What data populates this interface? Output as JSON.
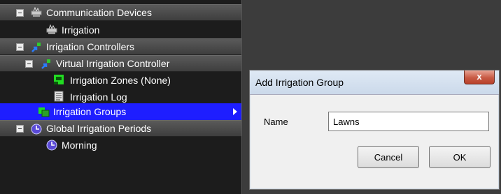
{
  "tree": {
    "items": [
      {
        "label": "Communication Devices",
        "icon": "communication-devices-icon",
        "type": "header"
      },
      {
        "label": "Irrigation",
        "icon": "communication-device-icon",
        "type": "child"
      },
      {
        "label": "Irrigation Controllers",
        "icon": "irrigation-controller-icon",
        "type": "header"
      },
      {
        "label": "Virtual Irrigation Controller",
        "icon": "virtual-controller-icon",
        "type": "header"
      },
      {
        "label": "Irrigation Zones (None)",
        "icon": "irrigation-zones-icon",
        "type": "child"
      },
      {
        "label": "Irrigation Log",
        "icon": "irrigation-log-icon",
        "type": "child"
      },
      {
        "label": "Irrigation Groups",
        "icon": "irrigation-groups-icon",
        "type": "selected"
      },
      {
        "label": "Global Irrigation Periods",
        "icon": "clock-icon",
        "type": "header"
      },
      {
        "label": "Morning",
        "icon": "clock-icon",
        "type": "child"
      }
    ]
  },
  "dialog": {
    "title": "Add Irrigation Group",
    "close_label": "x",
    "name_label": "Name",
    "name_value": "Lawns",
    "cancel_label": "Cancel",
    "ok_label": "OK"
  },
  "colors": {
    "selected_row": "#1e1eff",
    "tree_background": "#1c1c1c",
    "close_button": "#c85a44"
  }
}
